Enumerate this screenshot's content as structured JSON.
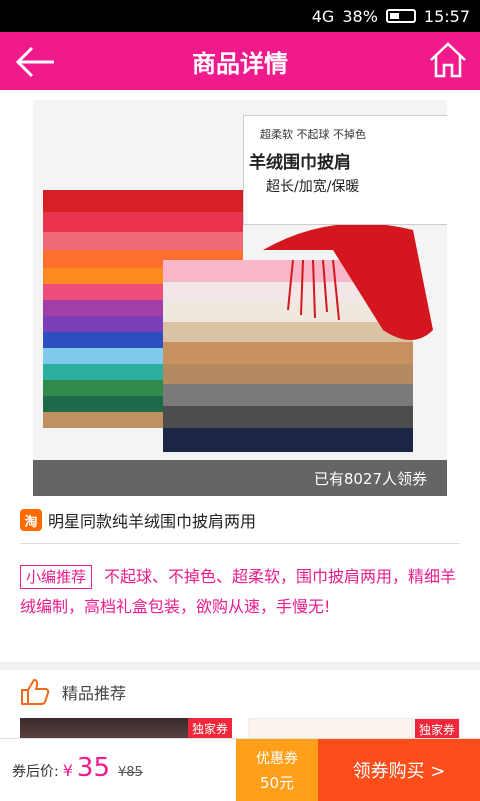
{
  "status": {
    "signal": "4G",
    "battery": "38%",
    "time": "15:57"
  },
  "header": {
    "title": "商品详情"
  },
  "product": {
    "image_badge": {
      "line1": "超柔软  不起球  不掉色",
      "line2": "羊绒围巾披肩",
      "line3": "超长/加宽/保暖"
    },
    "coupon_overlay": "已有8027人领券",
    "source_icon": "淘",
    "name": "明星同款纯羊绒围巾披肩两用"
  },
  "recommend": {
    "tag": "小编推荐",
    "text": "不起球、不掉色、超柔软，围巾披肩两用，精细羊绒编制，高档礼盒包装，欲购从速，手慢无!"
  },
  "section": {
    "title": "精品推荐",
    "exclusive_label": "独家券"
  },
  "bottom": {
    "price_label": "券后价:",
    "currency": "¥",
    "price_now": "35",
    "price_old": "¥85",
    "coupon_label": "优惠券",
    "coupon_amount": "50元",
    "buy_label": "领券购买 >"
  },
  "colors": {
    "brand": "#f01a8c",
    "coupon": "#ff9f1a",
    "buy": "#fc4d1a"
  }
}
